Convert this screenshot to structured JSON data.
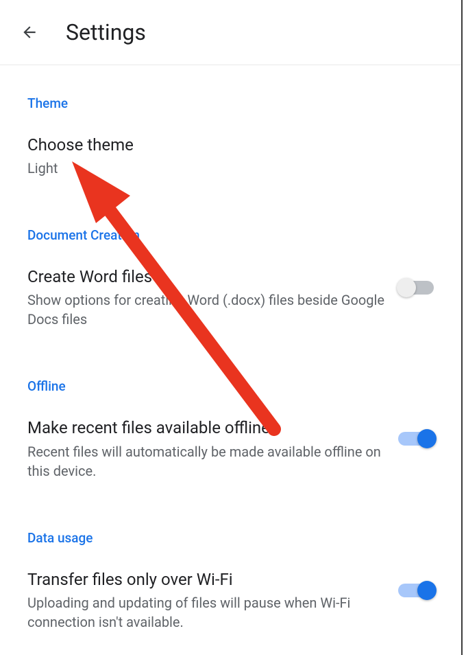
{
  "header": {
    "title": "Settings"
  },
  "sections": {
    "theme": {
      "header": "Theme",
      "choose": {
        "title": "Choose theme",
        "value": "Light"
      }
    },
    "documentCreation": {
      "header": "Document Creation",
      "createWord": {
        "title": "Create Word files",
        "subtitle": "Show options for creating Word (.docx) files beside Google Docs files",
        "enabled": false
      }
    },
    "offline": {
      "header": "Offline",
      "makeRecent": {
        "title": "Make recent files available offline",
        "subtitle": "Recent files will automatically be made available offline on this device.",
        "enabled": true
      }
    },
    "dataUsage": {
      "header": "Data usage",
      "wifiOnly": {
        "title": "Transfer files only over Wi-Fi",
        "subtitle": "Uploading and updating of files will pause when Wi-Fi connection isn't available.",
        "enabled": true
      }
    }
  },
  "colors": {
    "accent": "#1a73e8",
    "text": "#202124",
    "subtext": "#5f6368",
    "annotation": "#e9341f"
  }
}
